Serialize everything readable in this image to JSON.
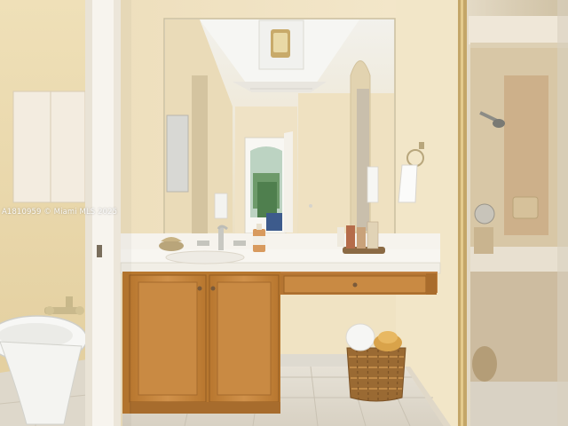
{
  "image": {
    "description_label": "bathroom-photo",
    "watermark": "A1810959 © Miami MLS 2025"
  },
  "palette": {
    "wall": "#f0e3c4",
    "wall_shadow": "#e3d1a8",
    "cabinet": "#c9883e",
    "cabinet_dark": "#a86d2c",
    "counter": "#f7f4ec",
    "floor_tile": "#e2ddd2",
    "glass_tint": "#ddd6c8",
    "mirror_ceiling": "#eef0f0"
  }
}
